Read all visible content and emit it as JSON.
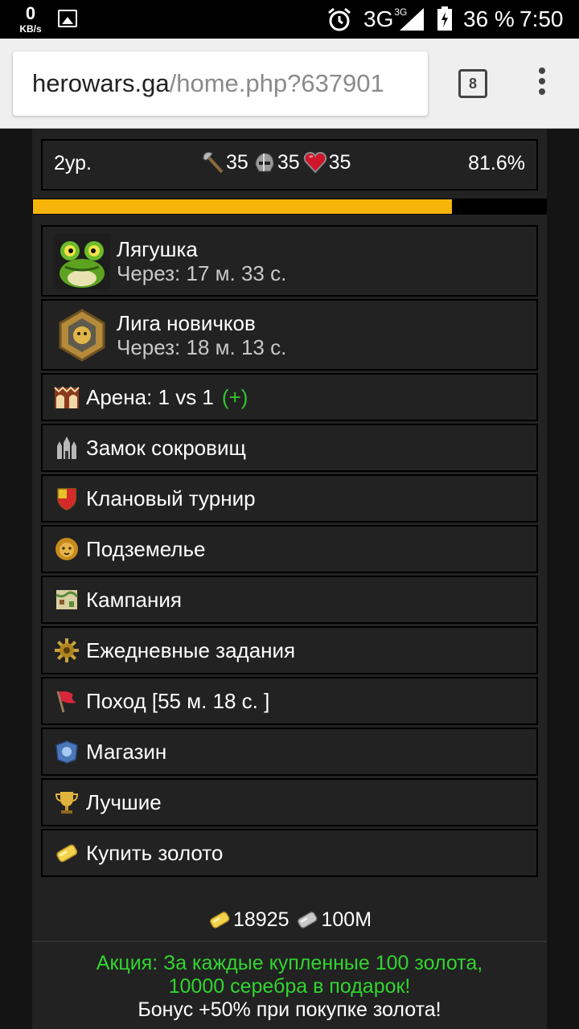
{
  "status_bar": {
    "net_speed": "0",
    "net_unit": "KB/s",
    "network": "3G",
    "network_sup": "3G",
    "battery": "36 %",
    "time": "7:50"
  },
  "browser": {
    "url_host": "herowars.ga",
    "url_path": "/home.php?637901",
    "tab_count": "8"
  },
  "stats": {
    "level": "2ур.",
    "attack": "35",
    "defense": "35",
    "health": "35",
    "progress_text": "81.6%",
    "progress_fraction": 0.816
  },
  "menu": {
    "frog_title": "Лягушка",
    "frog_timer": "Через: 17 м. 33 с.",
    "league_title": "Лига новичков",
    "league_timer": "Через: 18 м. 13 с.",
    "arena": "Арена: 1 vs 1",
    "arena_plus": "(+)",
    "castle": "Замок сокровищ",
    "clan_tournament": "Клановый турнир",
    "dungeon": "Подземелье",
    "campaign": "Кампания",
    "daily": "Ежедневные задания",
    "march": "Поход [55 м. 18 с. ]",
    "shop": "Магазин",
    "best": "Лучшие",
    "buy_gold": "Купить золото"
  },
  "currency": {
    "gold": "18925",
    "silver": "100M"
  },
  "promo": {
    "line1": "Акция: За каждые купленные 100 золота,",
    "line2": "10000 серебра в подарок!",
    "line3": "Бонус +50% при покупке золота!"
  },
  "colors": {
    "accent_bar": "#f7b50b",
    "promo_green": "#31d52f",
    "panel": "#222222"
  },
  "icons": [
    "image-icon",
    "alarm-icon",
    "signal-icon",
    "battery-icon",
    "tabs-icon",
    "menu-icon",
    "axe-icon",
    "helmet-icon",
    "heart-icon",
    "frog-icon",
    "league-badge-icon",
    "arena-icon",
    "castle-icon",
    "clan-shield-icon",
    "lion-icon",
    "map-icon",
    "gear-icon",
    "flag-icon",
    "shop-icon",
    "trophy-icon",
    "gold-icon",
    "silver-icon"
  ]
}
